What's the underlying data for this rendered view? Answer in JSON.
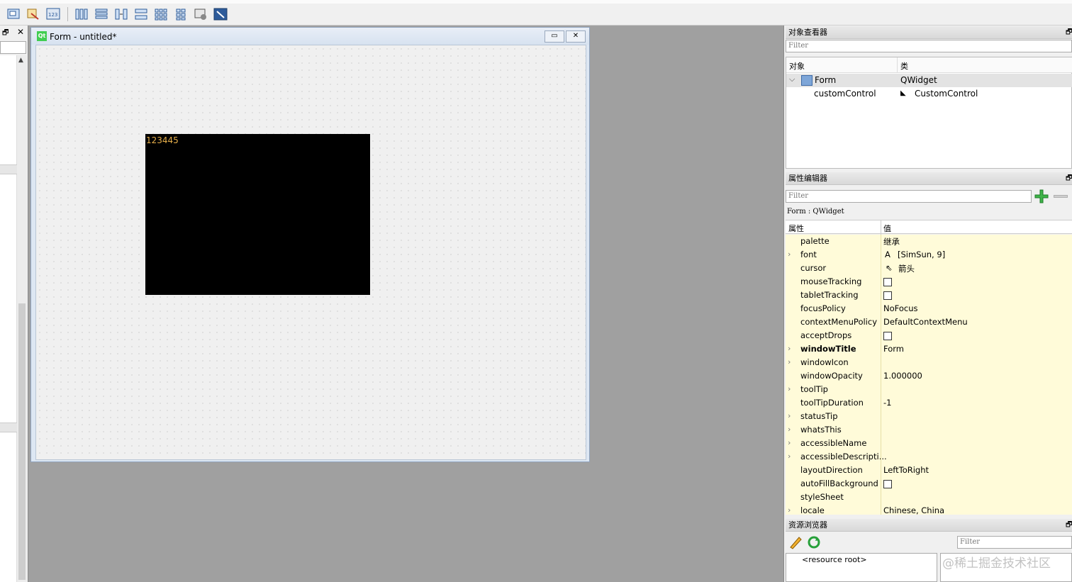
{
  "toolbar": {
    "icons": [
      "edit-widgets-icon",
      "edit-signals-icon",
      "edit-buddies-icon",
      "edit-tab-order-icon",
      "layout-horizontal-icon",
      "layout-vertical-icon",
      "layout-h-splitter-icon",
      "layout-v-splitter-icon",
      "layout-grid-icon",
      "layout-form-icon",
      "break-layout-icon",
      "adjust-size-icon"
    ]
  },
  "form_window": {
    "logo": "Qt",
    "title": "Form - untitled*",
    "custom_control_text": "123445"
  },
  "object_inspector": {
    "title": "对象查看器",
    "filter_placeholder": "Filter",
    "col_object": "对象",
    "col_class": "类",
    "rows": [
      {
        "object": "Form",
        "class": "QWidget"
      },
      {
        "object": "customControl",
        "class": "CustomControl"
      }
    ]
  },
  "property_editor": {
    "title": "属性编辑器",
    "filter_placeholder": "Filter",
    "context": "Form : QWidget",
    "col_property": "属性",
    "col_value": "值",
    "rows": [
      {
        "name": "palette",
        "value": "继承",
        "expand": false
      },
      {
        "name": "font",
        "value": "[SimSun, 9]",
        "expand": true
      },
      {
        "name": "cursor",
        "value": "箭头",
        "expand": false
      },
      {
        "name": "mouseTracking",
        "value": "",
        "expand": false
      },
      {
        "name": "tabletTracking",
        "value": "",
        "expand": false
      },
      {
        "name": "focusPolicy",
        "value": "NoFocus",
        "expand": false
      },
      {
        "name": "contextMenuPolicy",
        "value": "DefaultContextMenu",
        "expand": false
      },
      {
        "name": "acceptDrops",
        "value": "",
        "expand": false
      },
      {
        "name": "windowTitle",
        "value": "Form",
        "expand": true
      },
      {
        "name": "windowIcon",
        "value": "",
        "expand": true
      },
      {
        "name": "windowOpacity",
        "value": "1.000000",
        "expand": false
      },
      {
        "name": "toolTip",
        "value": "",
        "expand": true
      },
      {
        "name": "toolTipDuration",
        "value": "-1",
        "expand": false
      },
      {
        "name": "statusTip",
        "value": "",
        "expand": true
      },
      {
        "name": "whatsThis",
        "value": "",
        "expand": true
      },
      {
        "name": "accessibleName",
        "value": "",
        "expand": true
      },
      {
        "name": "accessibleDescripti...",
        "value": "",
        "expand": true
      },
      {
        "name": "layoutDirection",
        "value": "LeftToRight",
        "expand": false
      },
      {
        "name": "autoFillBackground",
        "value": "",
        "expand": false
      },
      {
        "name": "styleSheet",
        "value": "",
        "expand": false
      },
      {
        "name": "locale",
        "value": "Chinese, China",
        "expand": true
      }
    ]
  },
  "resource_browser": {
    "title": "资源浏览器",
    "filter_placeholder": "Filter",
    "root": "<resource root>"
  },
  "watermark": "@稀土掘金技术社区"
}
